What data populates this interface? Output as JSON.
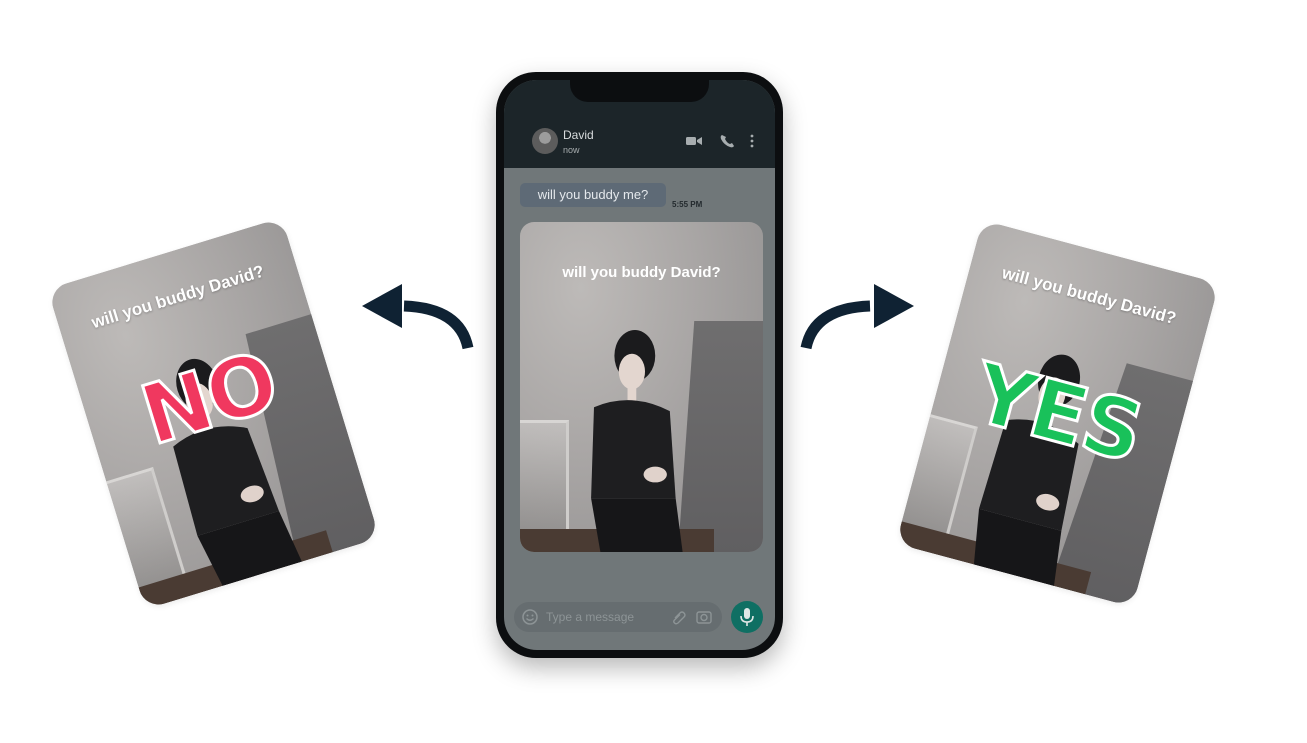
{
  "cards": {
    "left": {
      "question": "will you buddy David?",
      "verdict": "NO"
    },
    "right": {
      "question": "will you buddy David?",
      "verdict": "YES"
    }
  },
  "phone": {
    "header": {
      "contact_name": "David",
      "status": "now"
    },
    "message": {
      "text": "will you buddy me?",
      "time": "5:55 PM"
    },
    "photo_message": {
      "question": "will you buddy David?"
    },
    "composer": {
      "placeholder": "Type a message"
    }
  },
  "colors": {
    "no": "#f0385f",
    "yes": "#19c15a",
    "arrow": "#0f2233",
    "header": "#1c2529",
    "mic": "#0f6f63"
  },
  "icons": [
    "avatar",
    "video-icon",
    "call-icon",
    "more-vert-icon",
    "emoji-icon",
    "attach-icon",
    "camera-icon",
    "mic-icon",
    "arrow-left-icon",
    "arrow-right-icon"
  ]
}
